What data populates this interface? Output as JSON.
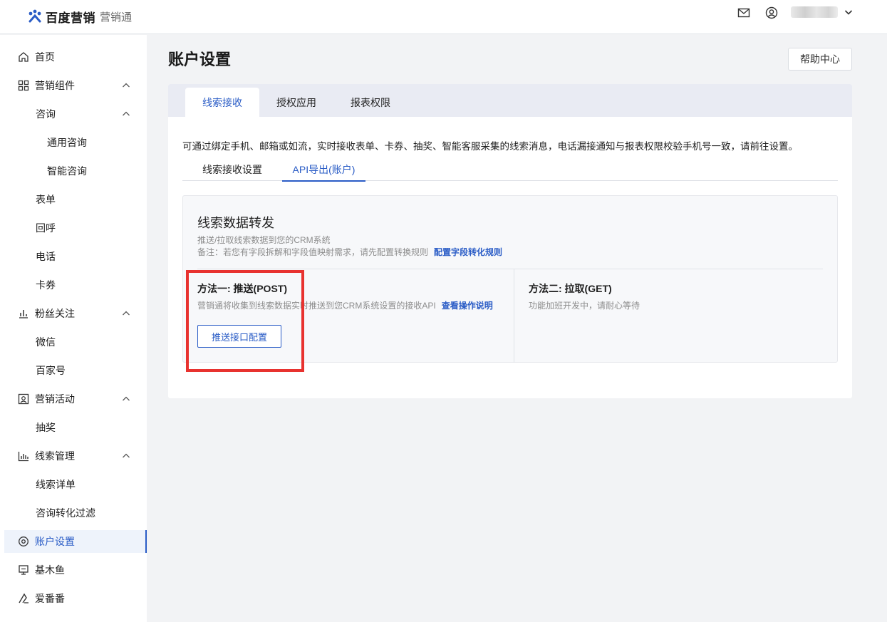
{
  "header": {
    "brand": "百度营销",
    "product": "营销通",
    "icons": [
      "mail-icon",
      "user-circle-icon",
      "chevron-down-icon"
    ]
  },
  "sidebar": {
    "items": [
      {
        "label": "首页",
        "icon": "home-icon",
        "level": 0
      },
      {
        "label": "营销组件",
        "icon": "grid-icon",
        "level": 0,
        "expanded": true
      },
      {
        "label": "咨询",
        "level": 1,
        "expanded": true
      },
      {
        "label": "通用咨询",
        "level": 2
      },
      {
        "label": "智能咨询",
        "level": 2
      },
      {
        "label": "表单",
        "level": 1
      },
      {
        "label": "回呼",
        "level": 1
      },
      {
        "label": "电话",
        "level": 1
      },
      {
        "label": "卡券",
        "level": 1
      },
      {
        "label": "粉丝关注",
        "icon": "bar-chart-icon",
        "level": 0,
        "expanded": true
      },
      {
        "label": "微信",
        "level": 1
      },
      {
        "label": "百家号",
        "level": 1
      },
      {
        "label": "营销活动",
        "icon": "activity-icon",
        "level": 0,
        "expanded": true
      },
      {
        "label": "抽奖",
        "level": 1
      },
      {
        "label": "线索管理",
        "icon": "stats-icon",
        "level": 0,
        "expanded": true
      },
      {
        "label": "线索详单",
        "level": 1
      },
      {
        "label": "咨询转化过滤",
        "level": 1
      },
      {
        "label": "账户设置",
        "icon": "settings-circle-icon",
        "level": 0,
        "active": true
      },
      {
        "label": "基木鱼",
        "icon": "monitor-icon",
        "level": 0
      },
      {
        "label": "爱番番",
        "icon": "pen-icon",
        "level": 0
      }
    ]
  },
  "main": {
    "title": "账户设置",
    "help_button": "帮助中心",
    "tabs": [
      {
        "label": "线索接收",
        "active": true
      },
      {
        "label": "授权应用",
        "active": false
      },
      {
        "label": "报表权限",
        "active": false
      }
    ],
    "description": "可通过绑定手机、邮箱或如流，实时接收表单、卡券、抽奖、智能客服采集的线索消息，电话漏接通知与报表权限校验手机号一致，请前往设置。",
    "subtabs": [
      {
        "label": "线索接收设置",
        "active": false
      },
      {
        "label": "API导出(账户)",
        "active": true
      }
    ],
    "panel": {
      "title": "线索数据转发",
      "note1": "推送/拉取线索数据到您的CRM系统",
      "note2": "备注：若您有字段拆解和字段值映射需求，请先配置转换规则",
      "note2_link": "配置字段转化规则",
      "method1": {
        "title": "方法一: 推送(POST)",
        "desc": "营销通将收集到线索数据实时推送到您CRM系统设置的接收API",
        "link": "查看操作说明",
        "button": "推送接口配置"
      },
      "method2": {
        "title": "方法二: 拉取(GET)",
        "desc": "功能加班开发中，请耐心等待"
      }
    }
  },
  "colors": {
    "accent": "#2a5cc6",
    "highlight": "#e8322f",
    "tabbar": "#e9ebf3",
    "page_bg": "#f2f3f5"
  }
}
